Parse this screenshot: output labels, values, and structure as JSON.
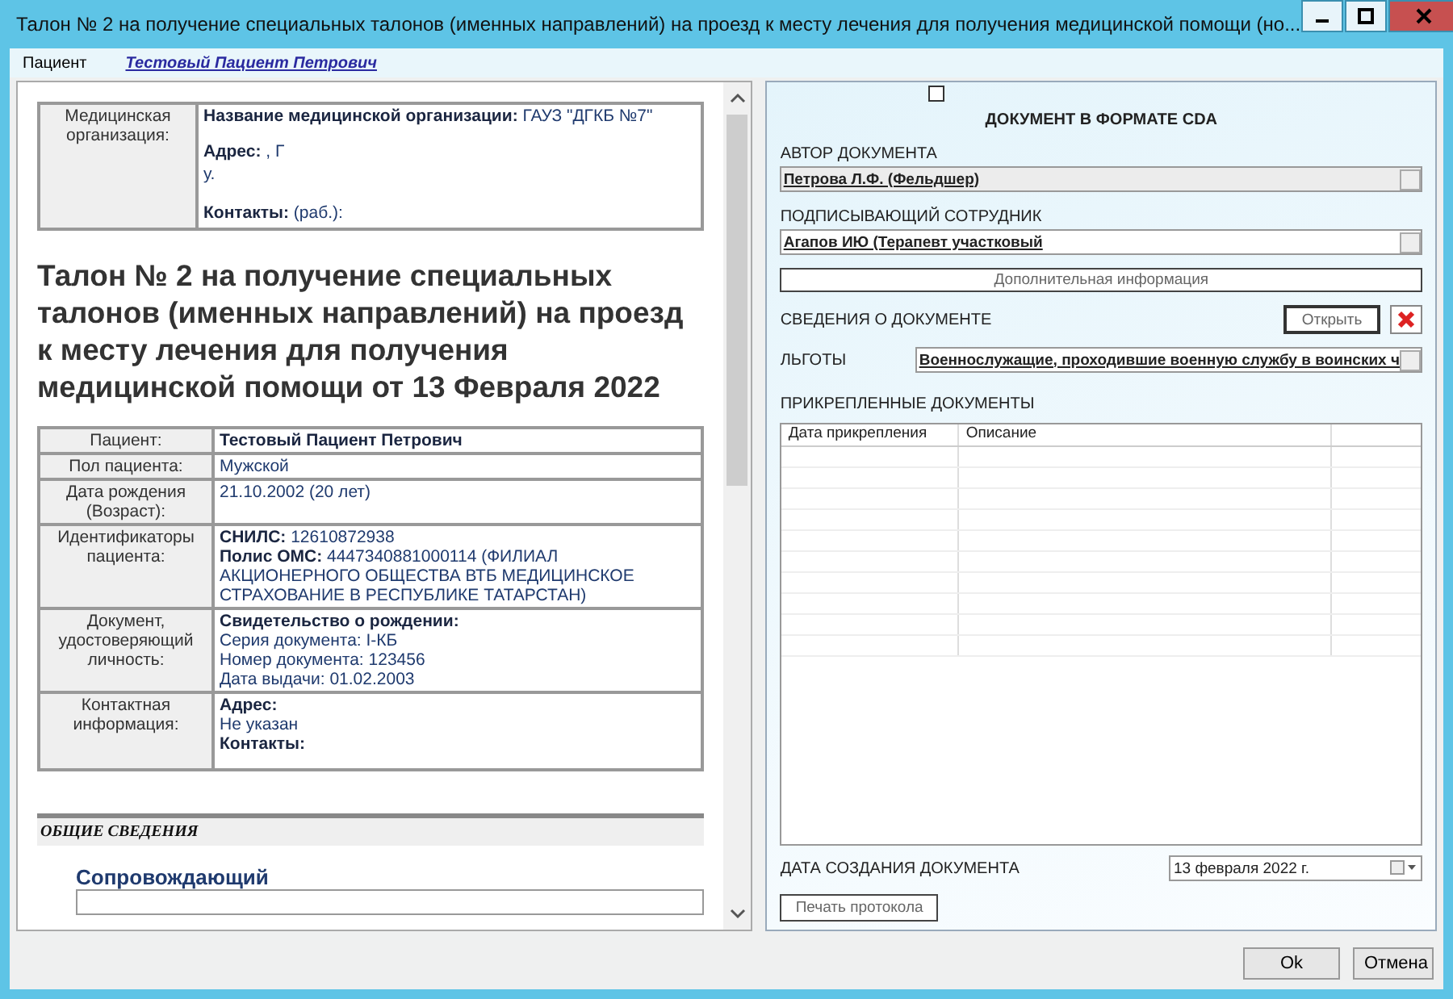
{
  "window": {
    "title": "Талон № 2 на получение специальных талонов (именных направлений) на проезд к месту лечения для получения медицинской помощи (но..."
  },
  "patient_bar": {
    "label": "Пациент",
    "link": "Тестовый Пациент Петрович"
  },
  "document": {
    "org": {
      "label": "Медицинская организация:",
      "name_label": "Название медицинской организации:",
      "name": "ГАУЗ \"ДГКБ №7\"",
      "address_label": "Адрес:",
      "address_lines": [
        ", Г",
        "у."
      ],
      "contacts_label": "Контакты:",
      "contacts": "(раб.):"
    },
    "heading": "Талон № 2 на получение специальных талонов (именных направлений) на проезд к месту лечения для получения медицинской помощи от 13 Февраля 2022",
    "rows": [
      {
        "label": "Пациент:",
        "lines": [
          {
            "bold": "Тестовый Пациент Петрович"
          }
        ]
      },
      {
        "label": "Пол пациента:",
        "lines": [
          {
            "text": "Мужской"
          }
        ]
      },
      {
        "label": "Дата рождения (Возраст):",
        "lines": [
          {
            "text": "21.10.2002 (20 лет)"
          }
        ]
      },
      {
        "label": "Идентификаторы пациента:",
        "lines": [
          {
            "bold": "СНИЛС:",
            "text": "12610872938"
          },
          {
            "bold": "Полис ОМС:",
            "text": "4447340881000114 (ФИЛИАЛ АКЦИОНЕРНОГО ОБЩЕСТВА ВТБ МЕДИЦИНСКОЕ СТРАХОВАНИЕ В РЕСПУБЛИКЕ ТАТАРСТАН)"
          }
        ]
      },
      {
        "label": "Документ, удостоверяющий личность:",
        "lines": [
          {
            "bold": "Свидетельство о рождении:"
          },
          {
            "text": "Серия документа: I-КБ"
          },
          {
            "text": "Номер документа: 123456"
          },
          {
            "text": "Дата выдачи: 01.02.2003"
          }
        ]
      },
      {
        "label": "Контактная информация:",
        "lines": [
          {
            "bold": "Адрес:"
          },
          {
            "text": "Не указан"
          },
          {
            "bold": "Контакты:"
          }
        ]
      }
    ],
    "section": "ОБЩИЕ СВЕДЕНИЯ",
    "subsection": "Сопровождающий"
  },
  "cda": {
    "checked": false,
    "title": "ДОКУМЕНТ В ФОРМАТЕ CDA",
    "author_label": "АВТОР ДОКУМЕНТА",
    "author": "Петрова Л.Ф. (Фельдшер)",
    "signer_label": "ПОДПИСЫВАЮЩИЙ СОТРУДНИК",
    "signer": "Агапов ИЮ (Терапевт участковый",
    "extra_button": "Дополнительная информация",
    "info_label": "СВЕДЕНИЯ О ДОКУМЕНТЕ",
    "open_button": "Открыть",
    "benefits_label": "ЛЬГОТЫ",
    "benefits": "Военнослужащие, проходившие военную службу в воинских ч",
    "attached_label": "ПРИКРЕПЛЕННЫЕ ДОКУМЕНТЫ",
    "attached_columns": [
      "Дата прикрепления",
      "Описание"
    ],
    "date_label": "ДАТА СОЗДАНИЯ ДОКУМЕНТА",
    "date": "13 февраля  2022 г.",
    "print_button": "Печать протокола"
  },
  "buttons": [
    "Ok",
    "Отмена"
  ]
}
